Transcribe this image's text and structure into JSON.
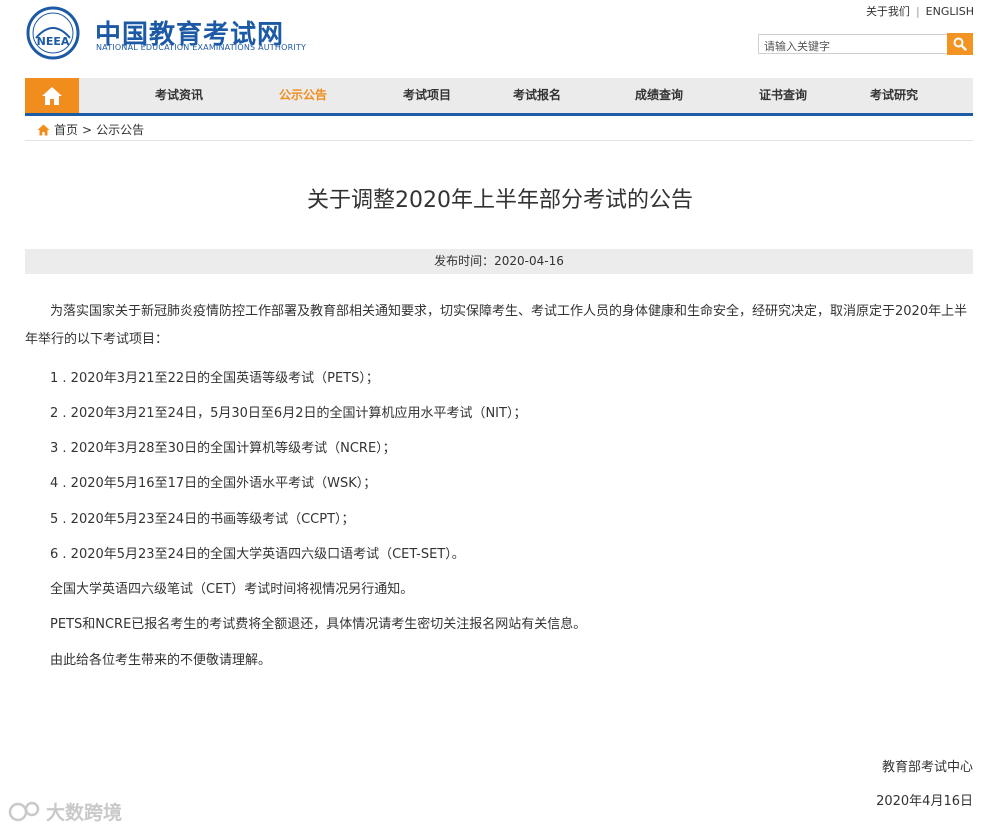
{
  "header": {
    "logo_mark_text": "NEEA",
    "logo_cn": "中国教育考试网",
    "logo_en": "NATIONAL EDUCATION EXAMINATIONS AUTHORITY",
    "links": [
      "关于我们",
      "ENGLISH"
    ],
    "search_placeholder": "请输入关键字",
    "brand_blue": "#1d5aa6",
    "accent_orange": "#f08d1c"
  },
  "nav": {
    "home_icon": "home-icon",
    "items": [
      "考试资讯",
      "公示公告",
      "考试项目",
      "考试报名",
      "成绩查询",
      "证书查询",
      "考试研究"
    ],
    "active_index": 1
  },
  "breadcrumb": {
    "icon": "home-icon",
    "home": "首页",
    "separator": ">",
    "current": "公示公告"
  },
  "article": {
    "title": "关于调整2020年上半年部分考试的公告",
    "date_label": "发布时间：2020-04-16",
    "intro": "为落实国家关于新冠肺炎疫情防控工作部署及教育部相关通知要求，切实保障考生、考试工作人员的身体健康和生命安全，经研究决定，取消原定于2020年上半年举行的以下考试项目：",
    "items": [
      "1 . 2020年3月21至22日的全国英语等级考试（PETS）；",
      "2 . 2020年3月21至24日，5月30日至6月2日的全国计算机应用水平考试（NIT）；",
      "3 . 2020年3月28至30日的全国计算机等级考试（NCRE）；",
      "4 . 2020年5月16至17日的全国外语水平考试（WSK）；",
      "5 . 2020年5月23至24日的书画等级考试（CCPT）；",
      "6 . 2020年5月23至24日的全国大学英语四六级口语考试（CET-SET）。"
    ],
    "notes": [
      "全国大学英语四六级笔试（CET）考试时间将视情况另行通知。",
      "PETS和NCRE已报名考生的考试费将全额退还，具体情况请考生密切关注报名网站有关信息。",
      "由此给各位考生带来的不便敬请理解。"
    ],
    "signature": "教育部考试中心",
    "sign_date": "2020年4月16日"
  },
  "watermark": "大数跨境"
}
